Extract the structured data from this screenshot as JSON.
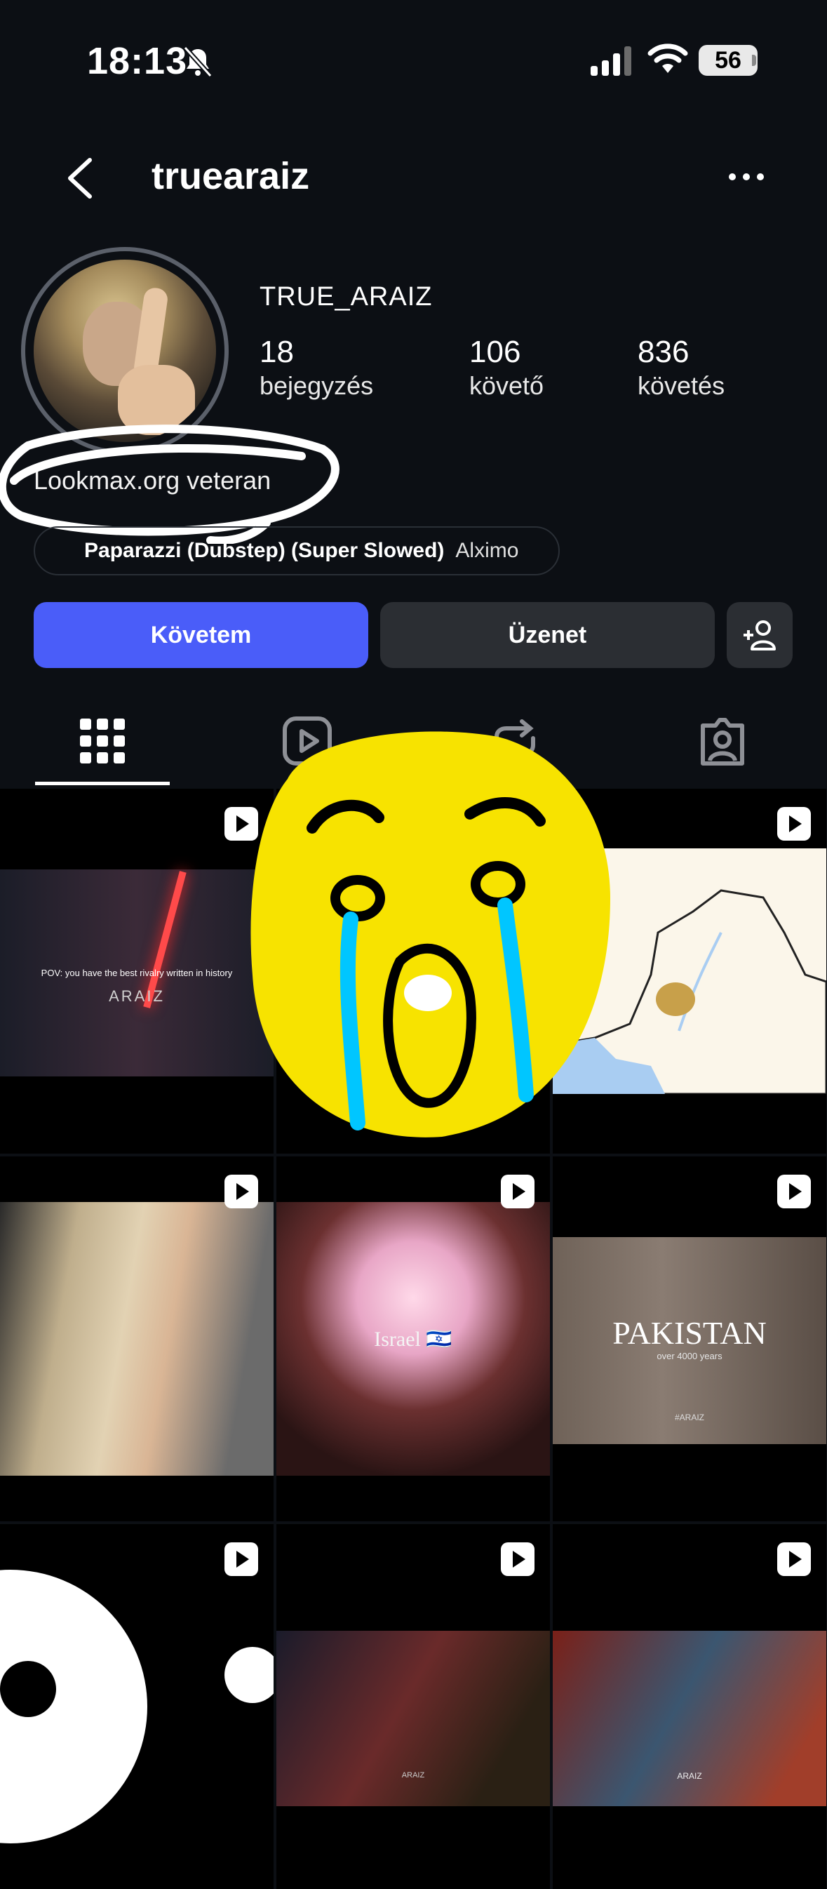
{
  "status_bar": {
    "time": "18:13",
    "battery": "56"
  },
  "nav": {
    "username": "truearaiz"
  },
  "profile": {
    "display_name": "TRUE_ARAIZ",
    "stats": [
      {
        "value": "18",
        "label": "bejegyzés"
      },
      {
        "value": "106",
        "label": "követő"
      },
      {
        "value": "836",
        "label": "követés"
      }
    ],
    "bio": "Lookmax.org veteran",
    "music": {
      "title": "Paparazzi (Dubstep) (Super Slowed)",
      "artist": "Alximo"
    }
  },
  "actions": {
    "follow_label": "Követem",
    "message_label": "Üzenet"
  },
  "grid": {
    "post1_caption": "POV: you have the best rivalry written in history",
    "post1_watermark": "ARAIZ",
    "post5_caption": "Israel 🇮🇱",
    "post6_title": "PAKISTAN",
    "post6_subtitle": "over 4000 years",
    "post6_watermark": "#ARAIZ",
    "post8_watermark": "ARAIZ",
    "post9_watermark": "ARAIZ"
  },
  "colors": {
    "follow_button": "#4a5df9",
    "secondary_button": "#2b2e33",
    "background": "#0c0f14"
  }
}
